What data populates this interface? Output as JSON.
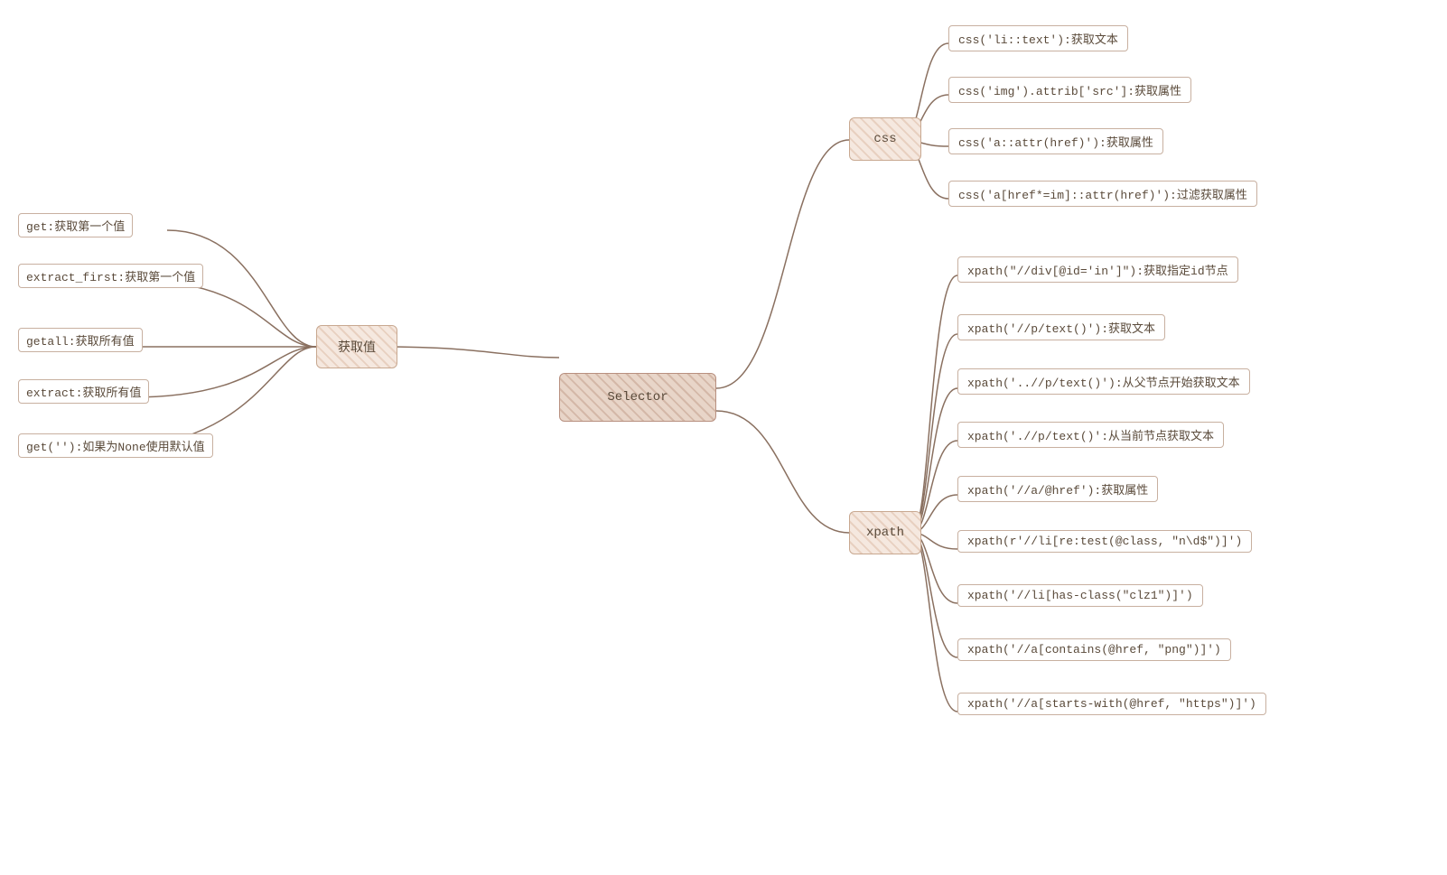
{
  "mindmap": {
    "center": "Selector",
    "left_branch": {
      "label": "获取值",
      "leaves": [
        "get:获取第一个值",
        "extract_first:获取第一个值",
        "getall:获取所有值",
        "extract:获取所有值",
        "get(''):如果为None使用默认值"
      ]
    },
    "right_branches": [
      {
        "label": "css",
        "leaves": [
          "css('li::text'):获取文本",
          "css('img').attrib['src']:获取属性",
          "css('a::attr(href)'):获取属性",
          "css('a[href*=im]::attr(href)'):过滤获取属性"
        ]
      },
      {
        "label": "xpath",
        "leaves": [
          "xpath(\"//div[@id='in']\"):获取指定id节点",
          "xpath('//p/text()'):获取文本",
          "xpath('..//p/text()'):从父节点开始获取文本",
          "xpath('.//p/text()':从当前节点获取文本",
          "xpath('//a/@href'):获取属性",
          "xpath(r'//li[re:test(@class, \"n\\d$\")]')",
          "xpath('//li[has-class(\"clz1\")]')",
          "xpath('//a[contains(@href, \"png\")]')",
          "xpath('//a[starts-with(@href, \"https\")]')"
        ]
      }
    ]
  }
}
